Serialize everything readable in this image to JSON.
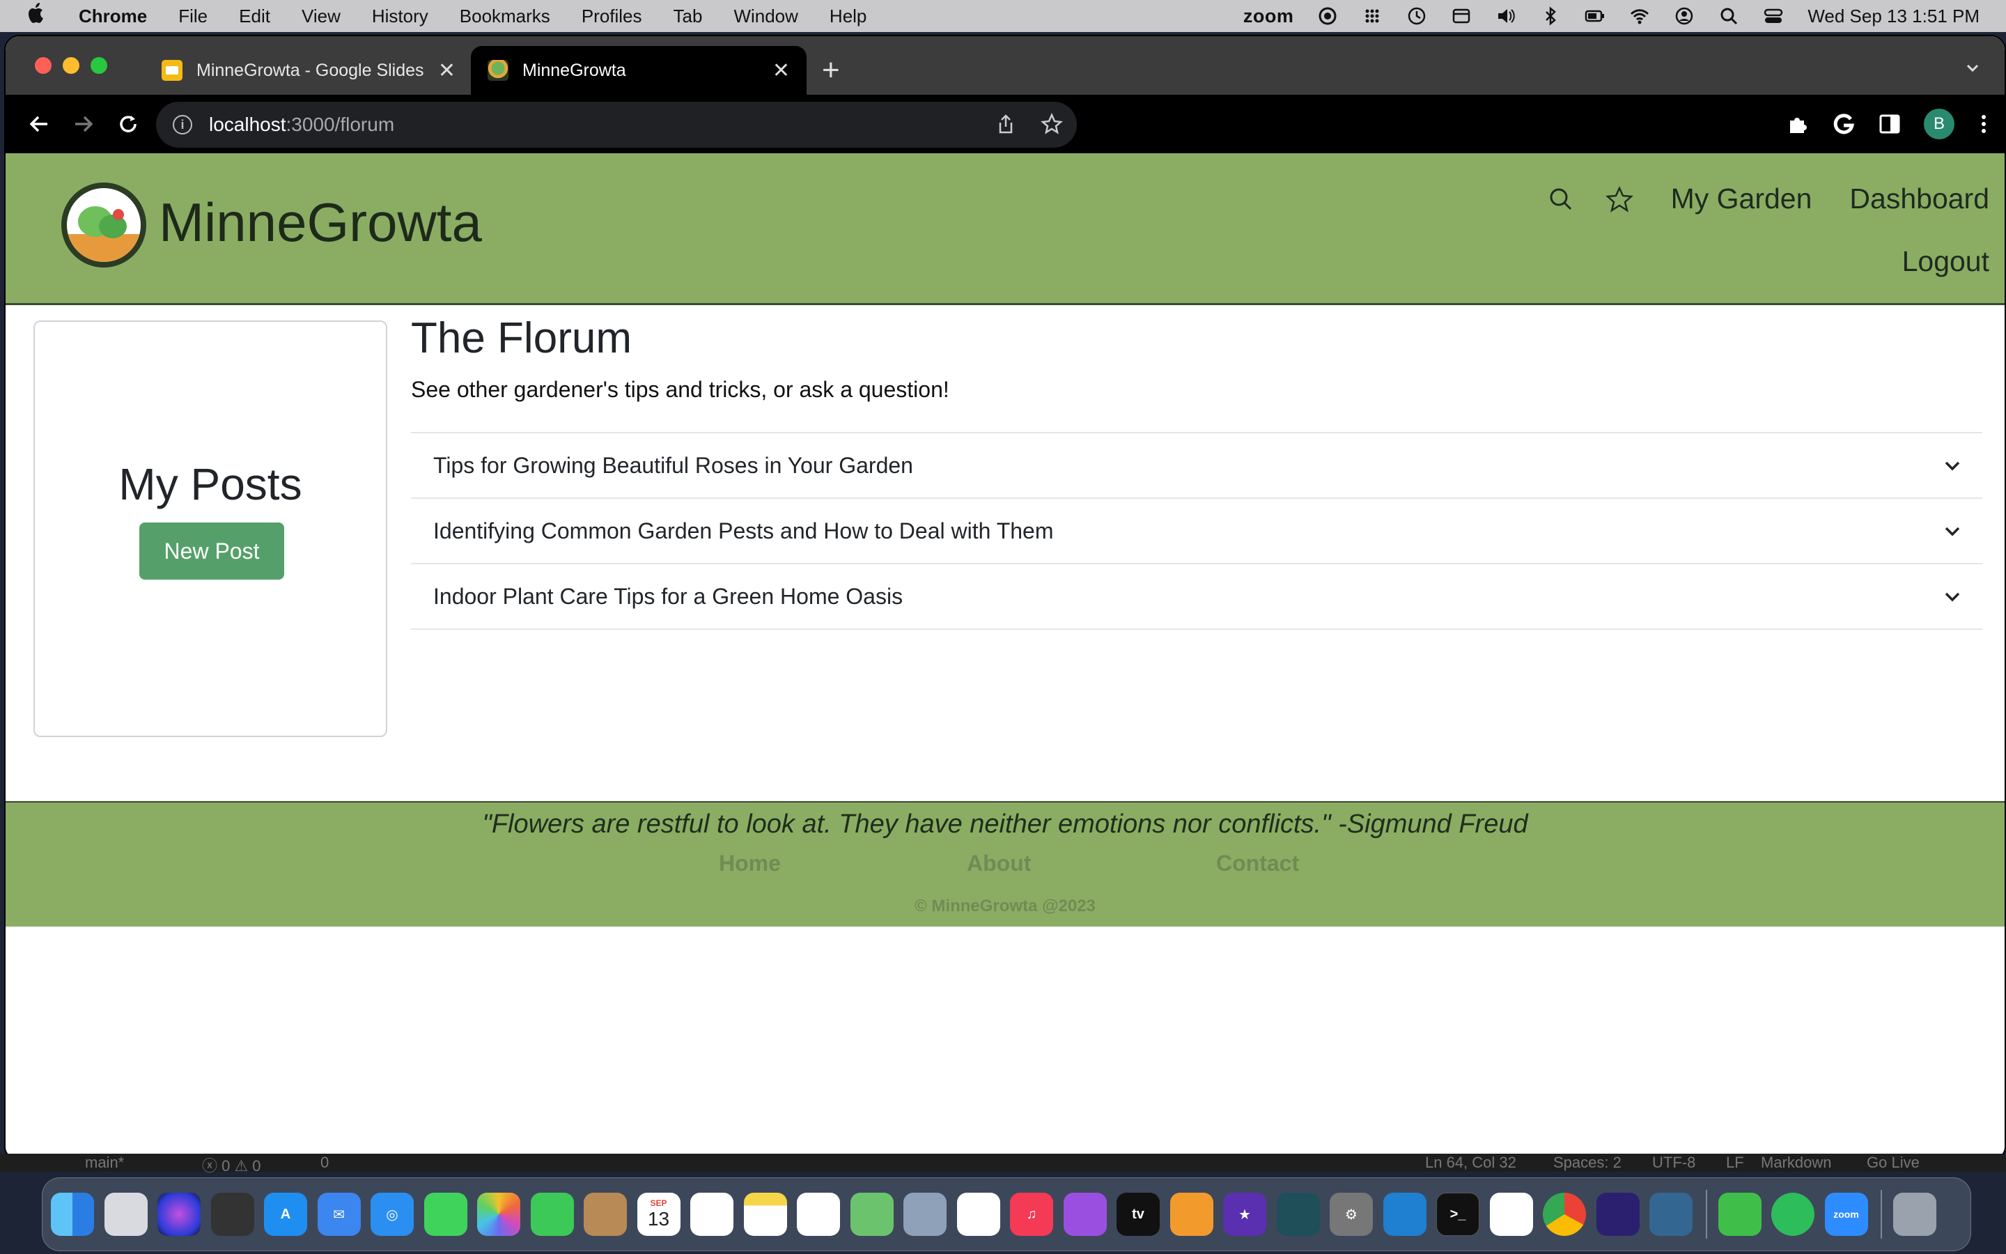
{
  "menubar": {
    "app": "Chrome",
    "items": [
      "File",
      "Edit",
      "View",
      "History",
      "Bookmarks",
      "Profiles",
      "Tab",
      "Window",
      "Help"
    ],
    "zoom_label": "zoom",
    "datetime": "Wed Sep 13  1:51 PM"
  },
  "browser": {
    "tabs": [
      {
        "title": "MinneGrowta - Google Slides",
        "favicon": "slides-icon"
      },
      {
        "title": "MinneGrowta",
        "favicon": "minnegrowta-icon",
        "active": true
      }
    ],
    "url_host": "localhost",
    "url_path": ":3000/florum",
    "profile_initial": "B"
  },
  "site": {
    "brand": "MinneGrowta",
    "nav": {
      "my_garden": "My Garden",
      "dashboard": "Dashboard",
      "logout": "Logout"
    }
  },
  "sidebar": {
    "title": "My Posts",
    "new_post_label": "New Post"
  },
  "forum": {
    "title": "The Florum",
    "subtitle": "See other gardener's tips and tricks, or ask a question!",
    "posts": [
      {
        "title": "Tips for Growing Beautiful Roses in Your Garden"
      },
      {
        "title": "Identifying Common Garden Pests and How to Deal with Them"
      },
      {
        "title": "Indoor Plant Care Tips for a Green Home Oasis"
      }
    ]
  },
  "footer": {
    "quote": "\"Flowers are restful to look at. They have neither emotions nor conflicts.\" -Sigmund Freud",
    "links": {
      "home": "Home",
      "about": "About",
      "contact": "Contact"
    },
    "copyright": "© MinneGrowta @2023"
  },
  "vscode_status": {
    "branch": "main*",
    "problems": "ⓧ 0 ⚠ 0",
    "ports": "0",
    "position": "Ln 64, Col 32",
    "spaces": "Spaces: 2",
    "encoding": "UTF-8",
    "eol": "LF",
    "language": "Markdown",
    "golive": "Go Live"
  },
  "dock": {
    "calendar_month": "SEP",
    "calendar_day": "13",
    "zoom_label": "zoom"
  },
  "colors": {
    "header_green": "#8bad63",
    "button_green": "#55a06a",
    "footer_link": "#6f8c55"
  }
}
